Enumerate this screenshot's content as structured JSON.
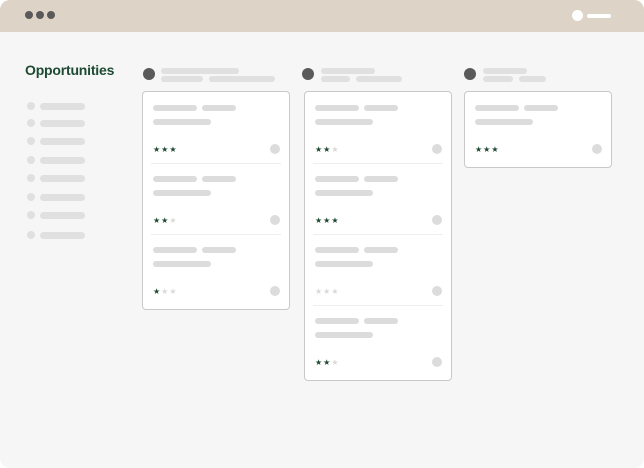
{
  "window": {
    "chrome_controls": [
      "dot-1",
      "dot-2",
      "dot-3"
    ]
  },
  "page": {
    "title": "Opportunities"
  },
  "sidebar": {
    "item_count": 8
  },
  "board": {
    "columns": [
      {
        "name": "column-1",
        "cards": [
          {
            "rating": 3
          },
          {
            "rating": 2
          },
          {
            "rating": 1
          }
        ]
      },
      {
        "name": "column-2",
        "cards": [
          {
            "rating": 2
          },
          {
            "rating": 3
          },
          {
            "rating": 0
          },
          {
            "rating": 2
          }
        ]
      },
      {
        "name": "column-3",
        "cards": [
          {
            "rating": 3
          }
        ]
      }
    ],
    "max_rating": 5,
    "shown_stars": 3
  },
  "colors": {
    "titlebar": "#ddd3c6",
    "background": "#f6f6f6",
    "accent": "#1e4a32",
    "skeleton": "#e0e0e0",
    "card_border": "#c9c9c9"
  }
}
